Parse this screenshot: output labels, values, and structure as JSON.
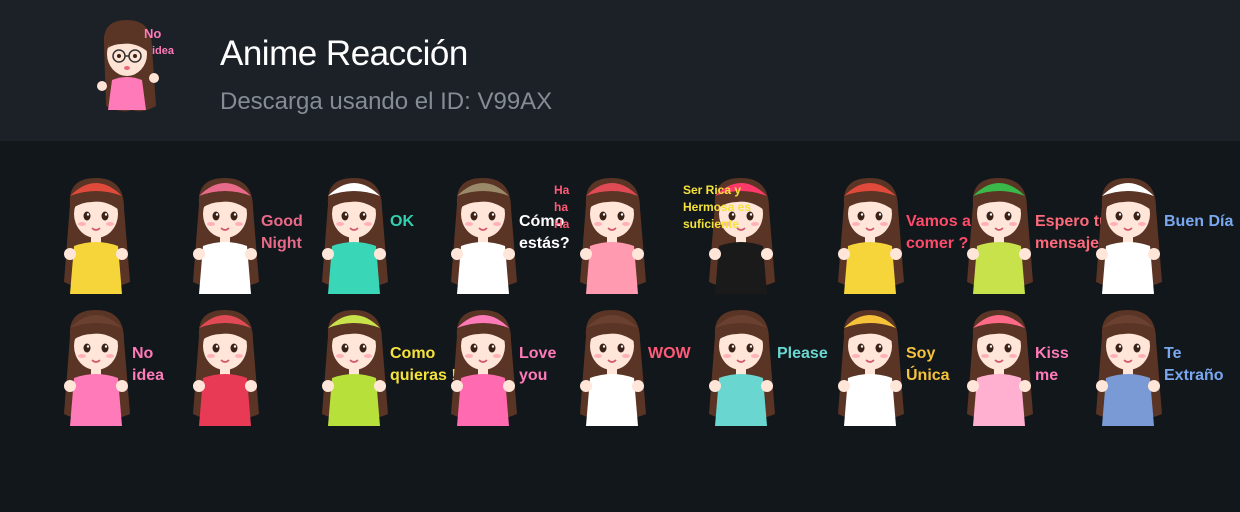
{
  "pack": {
    "title": "Anime Reacción",
    "subtitle": "Descarga usando el ID: V99AX",
    "icon_caption_1": "No",
    "icon_caption_2": "idea"
  },
  "stickers": [
    {
      "row": 0,
      "col": 0,
      "hair_top": "#e04a3a",
      "shirt": "#f5d53a",
      "lines": [],
      "caption_color": "#ffffff"
    },
    {
      "row": 0,
      "col": 1,
      "hair_top": "#e86a8a",
      "shirt": "#ffffff",
      "lines": [
        "Good",
        "Night"
      ],
      "caption_color": "#e96a88"
    },
    {
      "row": 0,
      "col": 2,
      "hair_top": "#ffffff",
      "shirt": "#3ad6b8",
      "lines": [
        "OK"
      ],
      "caption_color": "#33d0b0"
    },
    {
      "row": 0,
      "col": 3,
      "hair_top": "#9a8a6a",
      "shirt": "#ffffff",
      "lines": [
        "Cómo",
        "estás?"
      ],
      "caption_color": "#ffffff"
    },
    {
      "row": 0,
      "col": 4,
      "hair_top": "#e04a55",
      "shirt": "#ff9ab0",
      "lines": [
        "Ha",
        "ha",
        "Ha"
      ],
      "caption_color": "#ff5a78"
    },
    {
      "row": 0,
      "col": 5,
      "hair_top": "#ff3a6a",
      "shirt": "#1a1a1a",
      "lines": [
        "Ser Rica y",
        "Hermosa es",
        "suficiente"
      ],
      "caption_color": "#f5e23a"
    },
    {
      "row": 0,
      "col": 6,
      "hair_top": "#e04a3a",
      "shirt": "#f5d53a",
      "lines": [
        "Vamos a",
        "comer ?"
      ],
      "caption_color": "#ff4a6a"
    },
    {
      "row": 0,
      "col": 7,
      "hair_top": "#3ab84a",
      "shirt": "#c7e24a",
      "lines": [
        "Espero tu",
        "mensaje"
      ],
      "caption_color": "#ff6a7a"
    },
    {
      "row": 0,
      "col": 8,
      "hair_top": "#ffffff",
      "shirt": "#ffffff",
      "lines": [
        "Buen Día"
      ],
      "caption_color": "#7aa8f0"
    },
    {
      "row": 1,
      "col": 0,
      "hair_top": "#6a4030",
      "shirt": "#ff7ab8",
      "lines": [
        "No",
        "idea"
      ],
      "caption_color": "#ff7ab8"
    },
    {
      "row": 1,
      "col": 1,
      "hair_top": "#e04a55",
      "shirt": "#e83a55",
      "lines": [],
      "caption_color": "#ffffff"
    },
    {
      "row": 1,
      "col": 2,
      "hair_top": "#c7e24a",
      "shirt": "#b8e03a",
      "lines": [
        "Como",
        "quieras !"
      ],
      "caption_color": "#f5e23a"
    },
    {
      "row": 1,
      "col": 3,
      "hair_top": "#ff7ab8",
      "shirt": "#ff6ab0",
      "lines": [
        "Love",
        "you"
      ],
      "caption_color": "#ff7ab8"
    },
    {
      "row": 1,
      "col": 4,
      "hair_top": "#6a4030",
      "shirt": "#ffffff",
      "lines": [
        "WOW"
      ],
      "caption_color": "#ff5a78"
    },
    {
      "row": 1,
      "col": 5,
      "hair_top": "#6a4030",
      "shirt": "#6ad6d0",
      "lines": [
        "Please"
      ],
      "caption_color": "#6ad6d0"
    },
    {
      "row": 1,
      "col": 6,
      "hair_top": "#f5c23a",
      "shirt": "#ffffff",
      "lines": [
        "Soy",
        "Única"
      ],
      "caption_color": "#f5c23a"
    },
    {
      "row": 1,
      "col": 7,
      "hair_top": "#ff6a88",
      "shirt": "#ffb0d0",
      "lines": [
        "Kiss",
        "me"
      ],
      "caption_color": "#ff7ab8"
    },
    {
      "row": 1,
      "col": 8,
      "hair_top": "#6a4030",
      "shirt": "#7a9ad6",
      "lines": [
        "Te",
        "Extraño"
      ],
      "caption_color": "#7aa8f0"
    }
  ]
}
